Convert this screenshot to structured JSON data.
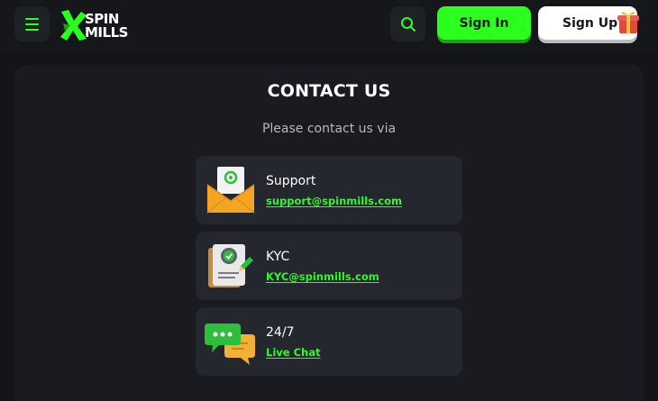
{
  "header": {
    "menu_icon": "hamburger-icon",
    "logo_text_line1": "SPIN",
    "logo_text_line2": "MILLS",
    "search_icon": "search-icon",
    "signin_label": "Sign In",
    "signup_label": "Sign Up",
    "gift_icon": "gift-icon"
  },
  "main": {
    "title": "CONTACT US",
    "subtitle": "Please contact us via",
    "contacts": [
      {
        "icon": "email-envelope-icon",
        "label": "Support",
        "link": "support@spinmills.com"
      },
      {
        "icon": "kyc-document-icon",
        "label": "KYC",
        "link": "KYC@spinmills.com"
      },
      {
        "icon": "chat-bubbles-icon",
        "label": "24/7",
        "link": "Live Chat"
      }
    ]
  },
  "colors": {
    "accent": "#2bff1e",
    "background": "#141519",
    "card": "#191b20",
    "contact_card": "#24272d"
  }
}
